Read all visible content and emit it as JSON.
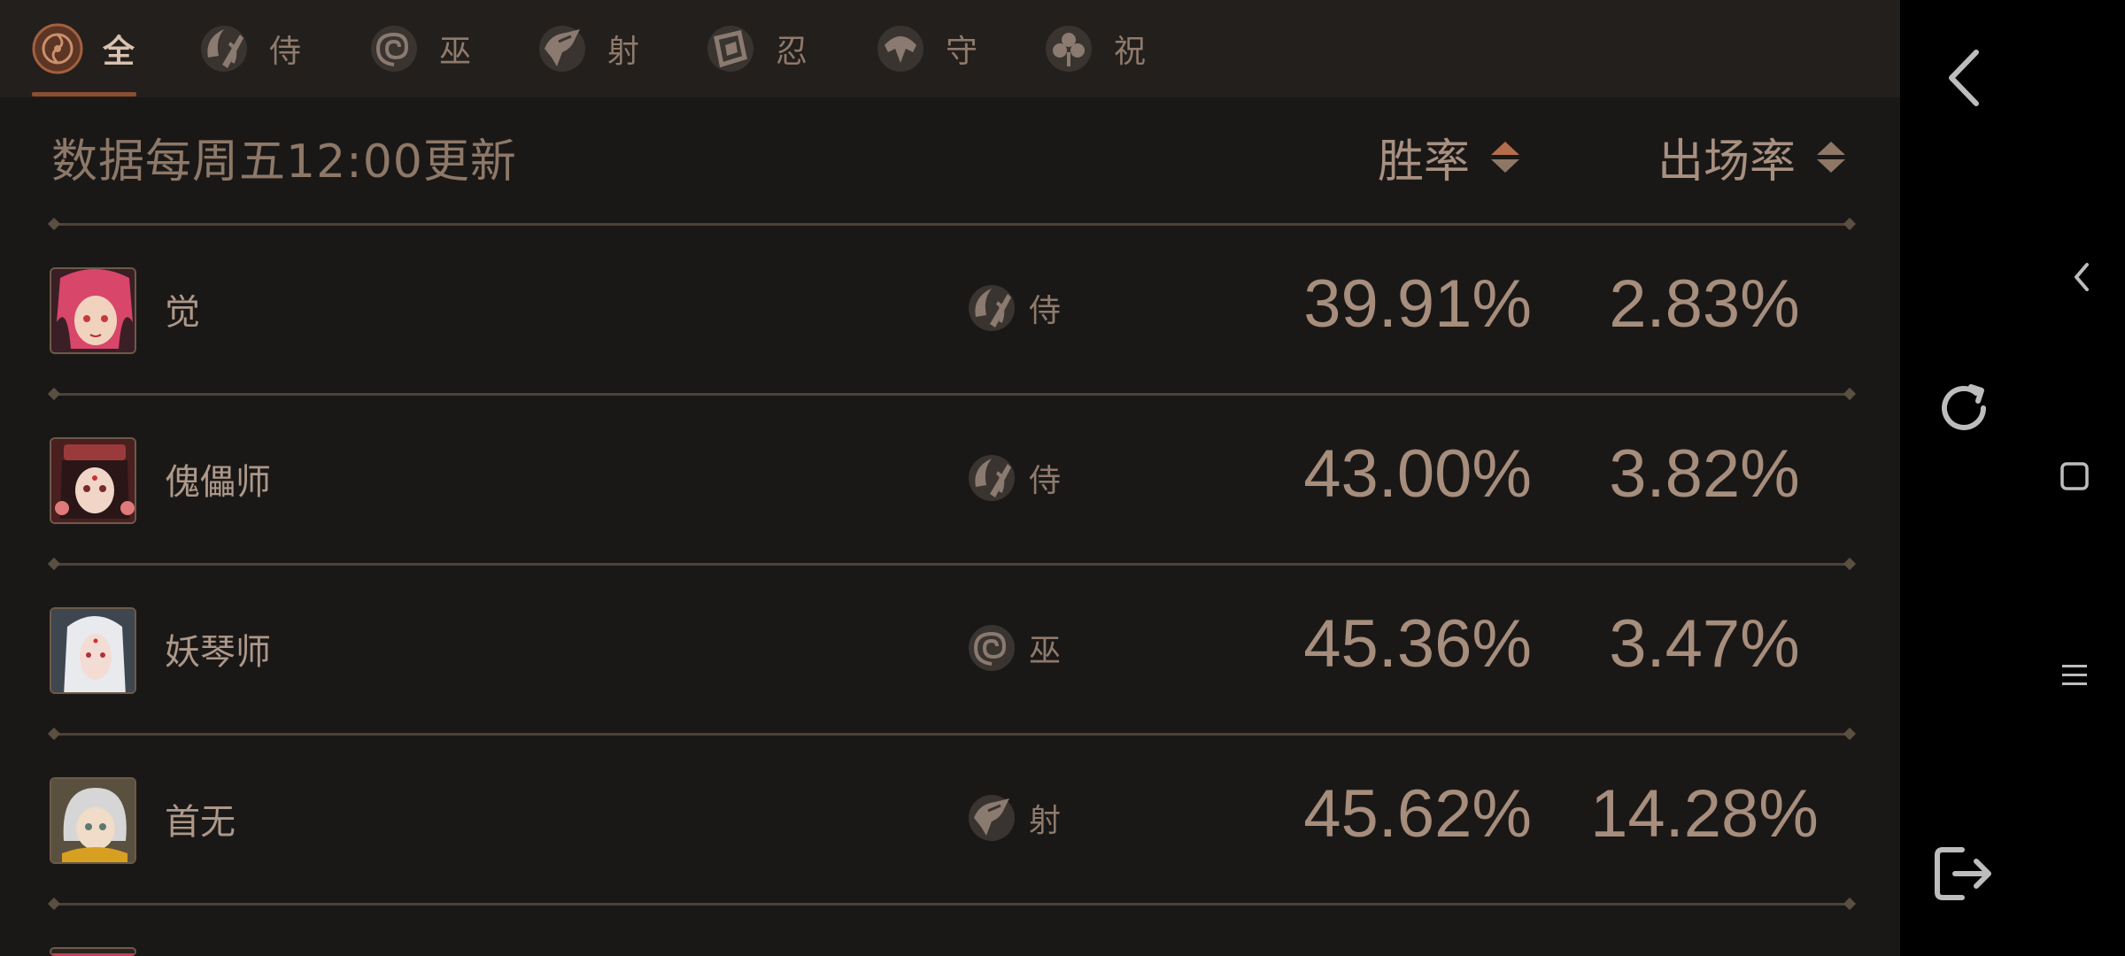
{
  "tabs": [
    {
      "label": "全",
      "icon": "all-class-icon",
      "active": true
    },
    {
      "label": "侍",
      "icon": "samurai-class-icon"
    },
    {
      "label": "巫",
      "icon": "shaman-class-icon"
    },
    {
      "label": "射",
      "icon": "archer-class-icon"
    },
    {
      "label": "忍",
      "icon": "ninja-class-icon"
    },
    {
      "label": "守",
      "icon": "guardian-class-icon"
    },
    {
      "label": "祝",
      "icon": "blessing-class-icon"
    }
  ],
  "header": {
    "update_note": "数据每周五12:00更新",
    "win_rate_label": "胜率",
    "pick_rate_label": "出场率"
  },
  "rows": [
    {
      "name": "觉",
      "class": "侍",
      "class_icon": "samurai-class-icon",
      "win_rate": "39.91%",
      "pick_rate": "2.83%",
      "avatar": "pink-haired-heroine"
    },
    {
      "name": "傀儡师",
      "class": "侍",
      "class_icon": "samurai-class-icon",
      "win_rate": "43.00%",
      "pick_rate": "3.82%",
      "avatar": "puppeteer-girl"
    },
    {
      "name": "妖琴师",
      "class": "巫",
      "class_icon": "shaman-class-icon",
      "win_rate": "45.36%",
      "pick_rate": "3.47%",
      "avatar": "white-haired-musician"
    },
    {
      "name": "首无",
      "class": "射",
      "class_icon": "archer-class-icon",
      "win_rate": "45.62%",
      "pick_rate": "14.28%",
      "avatar": "silver-haired-youth"
    }
  ],
  "colors": {
    "background": "#1a1817",
    "tab_bar": "#231f1c",
    "accent": "#8a4e33",
    "text": "#a68d7c"
  },
  "system_nav": [
    "back-icon",
    "small-back-icon",
    "refresh-icon",
    "home-square-icon",
    "menu-icon",
    "exit-icon"
  ]
}
